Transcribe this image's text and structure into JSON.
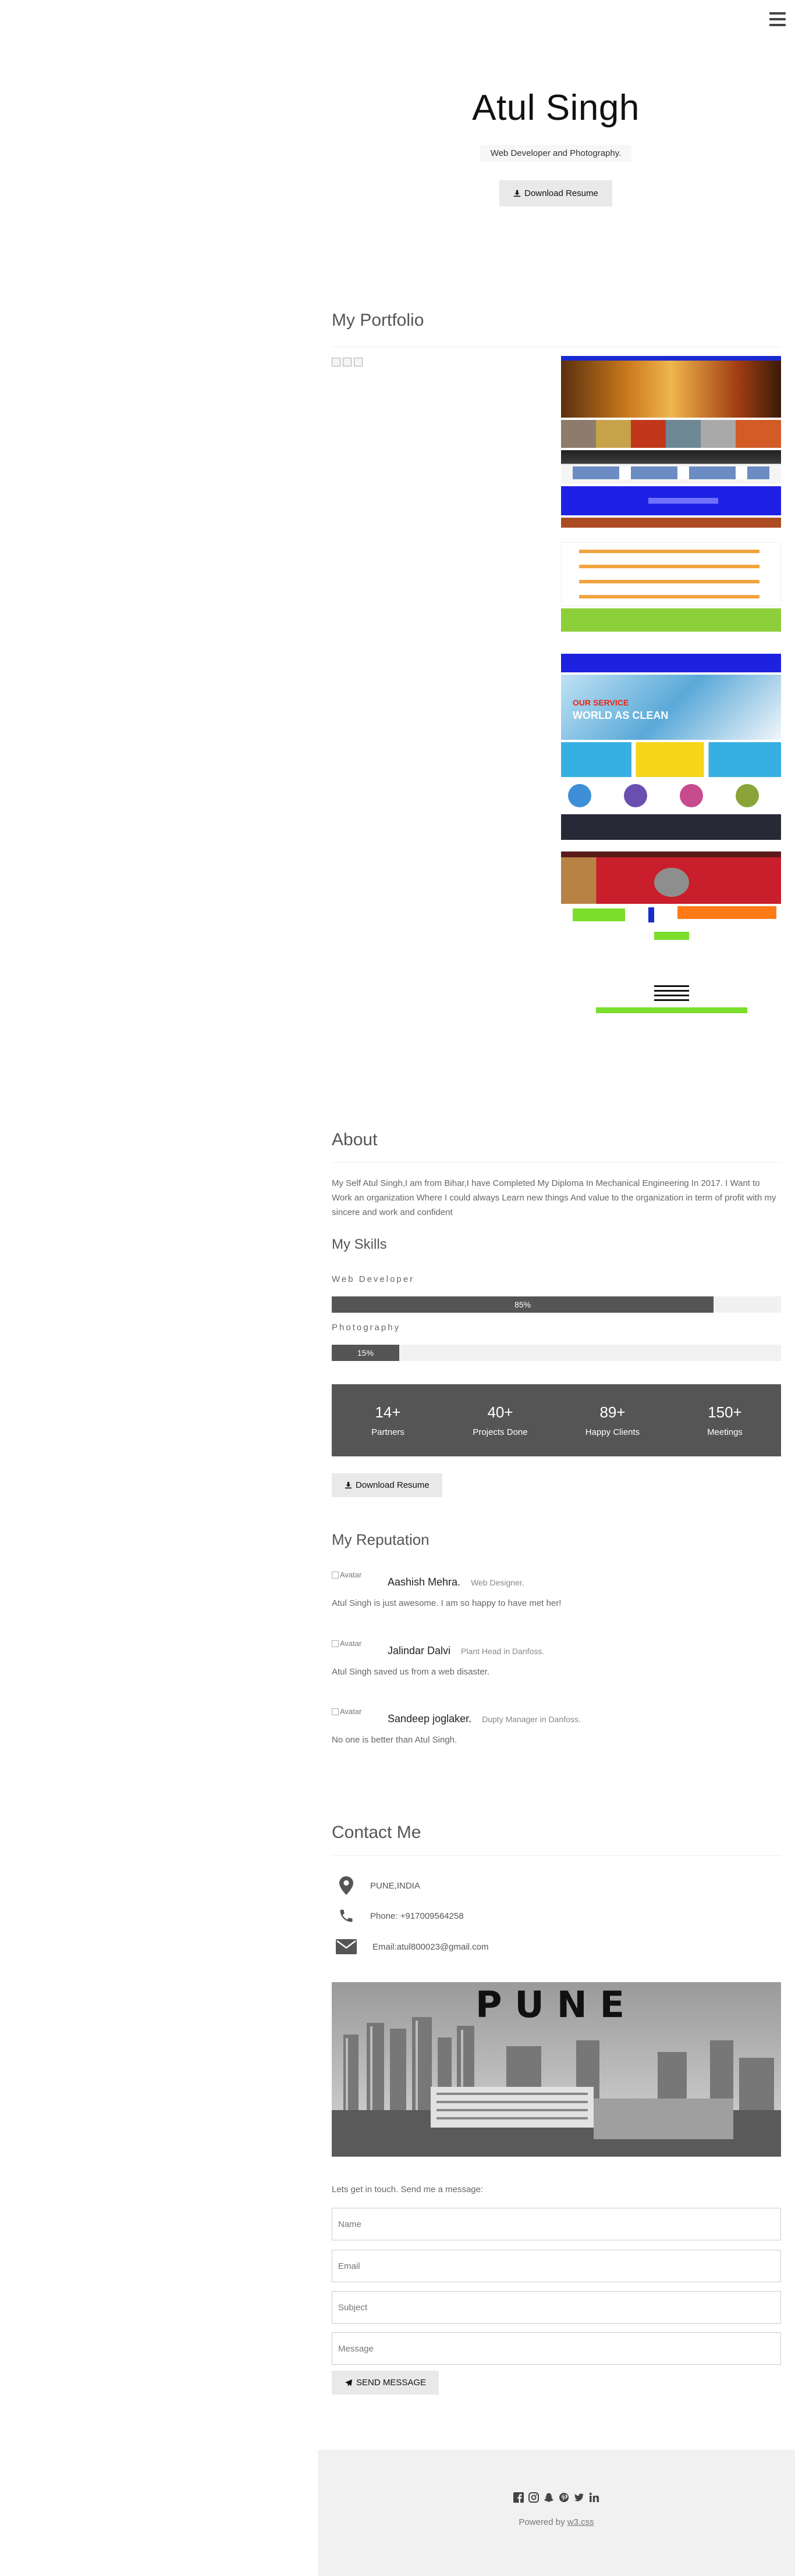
{
  "nav": {
    "menu_icon": "hamburger-menu-icon"
  },
  "hero": {
    "name": "Atul Singh",
    "tagline": "Web Developer and Photography.",
    "download_label": "Download Resume",
    "download_icon": "download-icon"
  },
  "portfolio": {
    "title": "My Portfolio"
  },
  "about": {
    "title": "About",
    "text": "My Self Atul Singh,I am from Bihar,I have Completed My Diploma In Mechanical Engineering In 2017. I Want to Work an organization Where I could always Learn new things And value to the organization in term of profit with my sincere and work and confident"
  },
  "skills": {
    "title": "My Skills",
    "items": [
      {
        "label": "Web Developer",
        "percent_text": "85%",
        "percent": 85
      },
      {
        "label": "Photography",
        "percent_text": "15%",
        "percent": 15
      }
    ]
  },
  "stats": [
    {
      "value": "14+",
      "label": "Partners"
    },
    {
      "value": "40+",
      "label": "Projects Done"
    },
    {
      "value": "89+",
      "label": "Happy Clients"
    },
    {
      "value": "150+",
      "label": "Meetings"
    }
  ],
  "resume_button": {
    "label": "Download Resume",
    "icon": "download-icon"
  },
  "reputation": {
    "title": "My Reputation",
    "avatar_alt": "Avatar",
    "items": [
      {
        "name": "Aashish Mehra.",
        "role": "Web Designer.",
        "quote": "Atul Singh is just awesome. I am so happy to have met her!"
      },
      {
        "name": "Jalindar Dalvi",
        "role": "Plant Head in Danfoss.",
        "quote": "Atul Singh saved us from a web disaster."
      },
      {
        "name": "Sandeep joglaker.",
        "role": "Dupty Manager in Danfoss.",
        "quote": "No one is better than Atul Singh."
      }
    ]
  },
  "contact": {
    "title": "Contact Me",
    "location": "PUNE,INDIA",
    "phone": "Phone: +917009564258",
    "email": "Email:atul800023@gmail.com",
    "map_label": "PUNE",
    "message_hint": "Lets get in touch. Send me a message:",
    "placeholders": {
      "name": "Name",
      "email": "Email",
      "subject": "Subject",
      "message": "Message"
    },
    "send_label": "SEND MESSAGE",
    "send_icon": "paper-plane-icon"
  },
  "footer": {
    "social_icons": [
      "facebook-icon",
      "instagram-icon",
      "snapchat-icon",
      "pinterest-icon",
      "twitter-icon",
      "linkedin-icon"
    ],
    "powered_text": "Powered by",
    "powered_link": "w3.css"
  },
  "colors": {
    "dark_gray": "#555555",
    "light_gray": "#f1f1f1",
    "button_gray": "#e9e9e9",
    "text_gray": "#666666"
  }
}
